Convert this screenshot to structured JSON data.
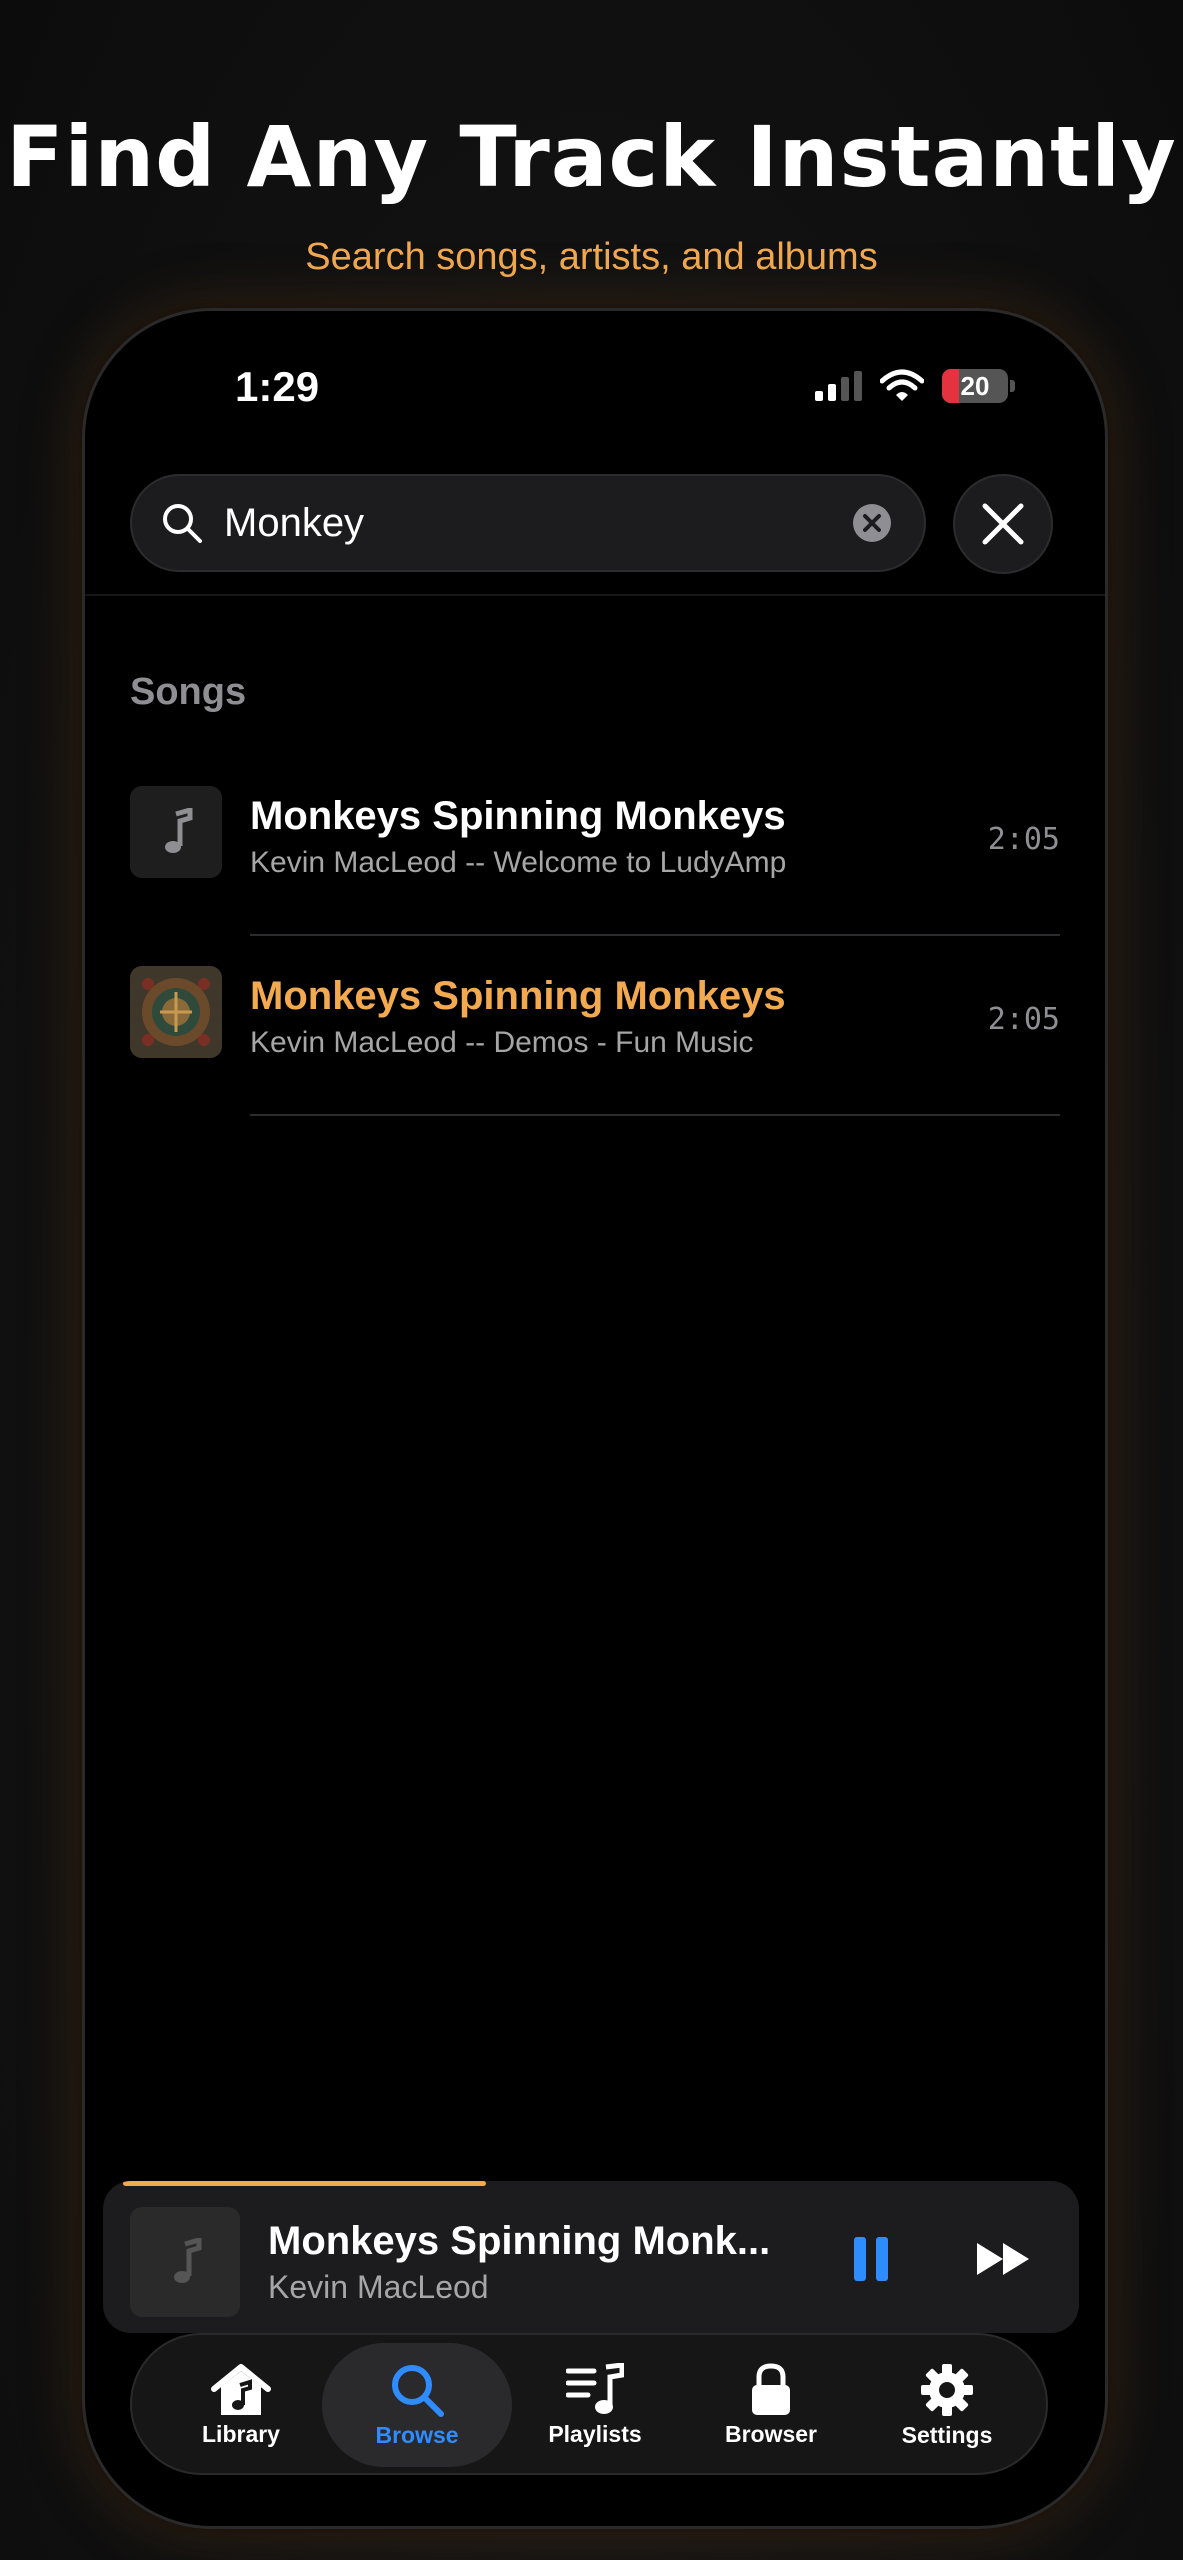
{
  "promo": {
    "headline": "Find Any Track Instantly",
    "tagline": "Search songs, artists, and albums"
  },
  "status_bar": {
    "time": "1:29",
    "battery": "20"
  },
  "search": {
    "query": "Monkey"
  },
  "results": {
    "section_title": "Songs",
    "songs": [
      {
        "title": "Monkeys Spinning Monkeys",
        "subtitle": "Kevin MacLeod -- Welcome to LudyAmp",
        "duration": "2:05",
        "playing": false
      },
      {
        "title": "Monkeys Spinning Monkeys",
        "subtitle": "Kevin MacLeod -- Demos - Fun Music",
        "duration": "2:05",
        "playing": true
      }
    ]
  },
  "now_playing": {
    "title": "Monkeys Spinning Monk...",
    "artist": "Kevin MacLeod",
    "progress": 0.38
  },
  "tabs": [
    {
      "label": "Library",
      "icon": "home-music-icon"
    },
    {
      "label": "Browse",
      "icon": "search-icon",
      "active": true
    },
    {
      "label": "Playlists",
      "icon": "playlist-icon"
    },
    {
      "label": "Browser",
      "icon": "lock-icon"
    },
    {
      "label": "Settings",
      "icon": "gear-icon"
    }
  ],
  "colors": {
    "accent": "#f2a94f",
    "active_blue": "#2f8cff",
    "background": "#000000"
  }
}
